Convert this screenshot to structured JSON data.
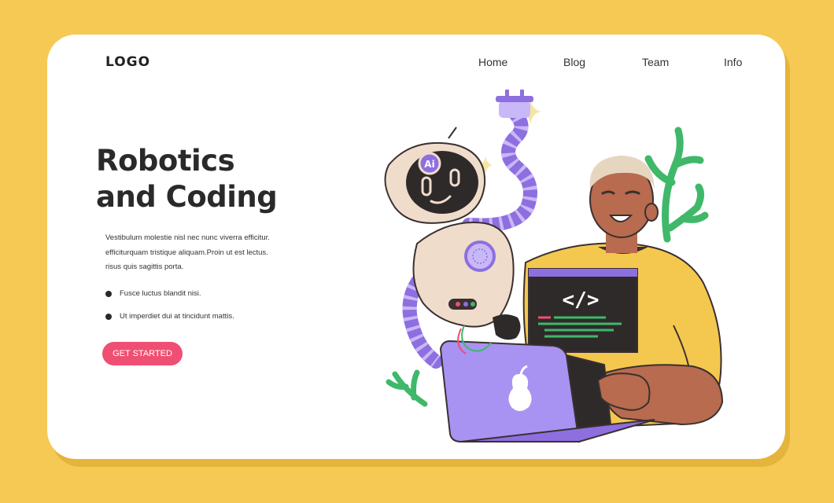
{
  "header": {
    "logo": "LOGO",
    "nav": [
      "Home",
      "Blog",
      "Team",
      "Info"
    ]
  },
  "hero": {
    "title_line1": "Robotics",
    "title_line2": "and Coding",
    "description_lines": [
      "Vestibulum molestie nisl nec nunc viverra efficitur.",
      "efficiturquam tristique aliquam.Proin ut est lectus.",
      "risus quis sagittis porta."
    ],
    "bullets": [
      "Fusce luctus blandit nisi.",
      "Ut imperdiet dui at tincidunt mattis."
    ],
    "cta_label": "GET STARTED"
  },
  "illustration": {
    "robot_badge": "Ai",
    "code_tag": "</>"
  },
  "colors": {
    "background": "#f5c953",
    "card": "#ffffff",
    "cta": "#ef4f72",
    "robot_purple": "#8e6fe0",
    "laptop": "#a893f2",
    "shirt": "#f4c84e",
    "leaf": "#3fb86a"
  }
}
